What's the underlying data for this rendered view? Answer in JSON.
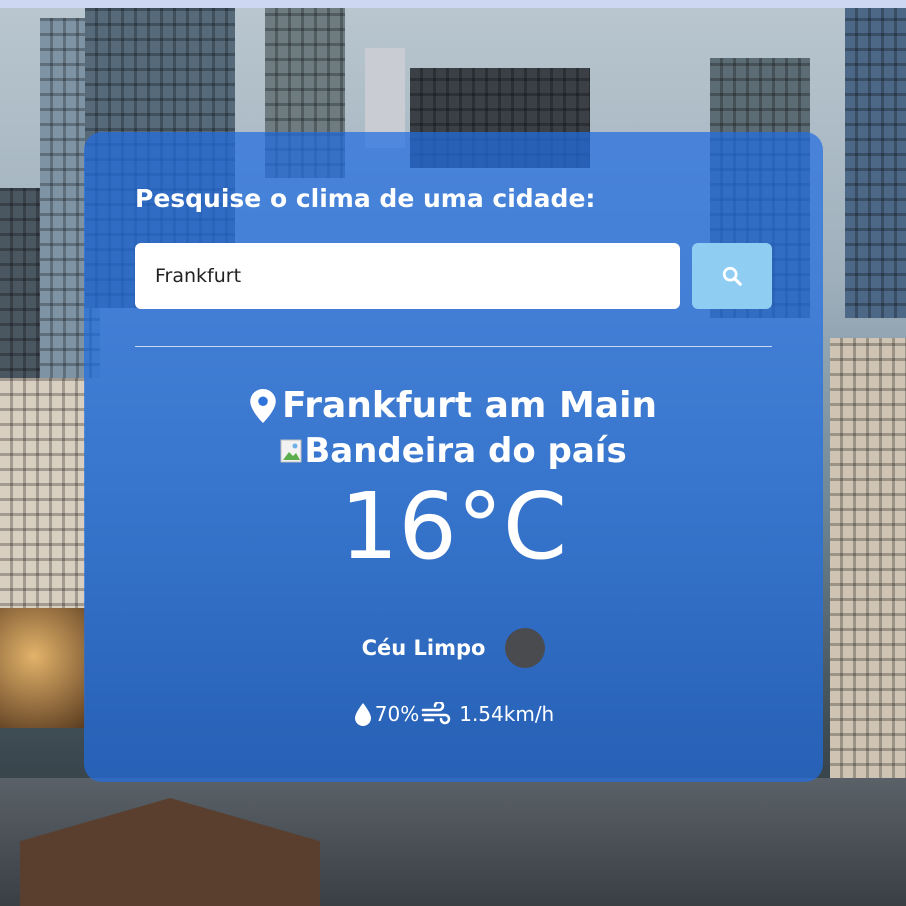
{
  "search": {
    "title": "Pesquise o clima de uma cidade:",
    "value": "Frankfurt"
  },
  "weather": {
    "city": "Frankfurt am Main",
    "flag_alt": "Bandeira do país",
    "temperature": "16°C",
    "description": "Céu Limpo",
    "humidity": "70%",
    "wind": "1.54km/h"
  },
  "colors": {
    "card": "#216ee1",
    "search_button": "#8fcdf2",
    "text": "#ffffff"
  },
  "icons": [
    "search-icon",
    "location-pin-icon",
    "broken-image-icon",
    "weather-condition-icon",
    "humidity-drop-icon",
    "wind-icon"
  ]
}
